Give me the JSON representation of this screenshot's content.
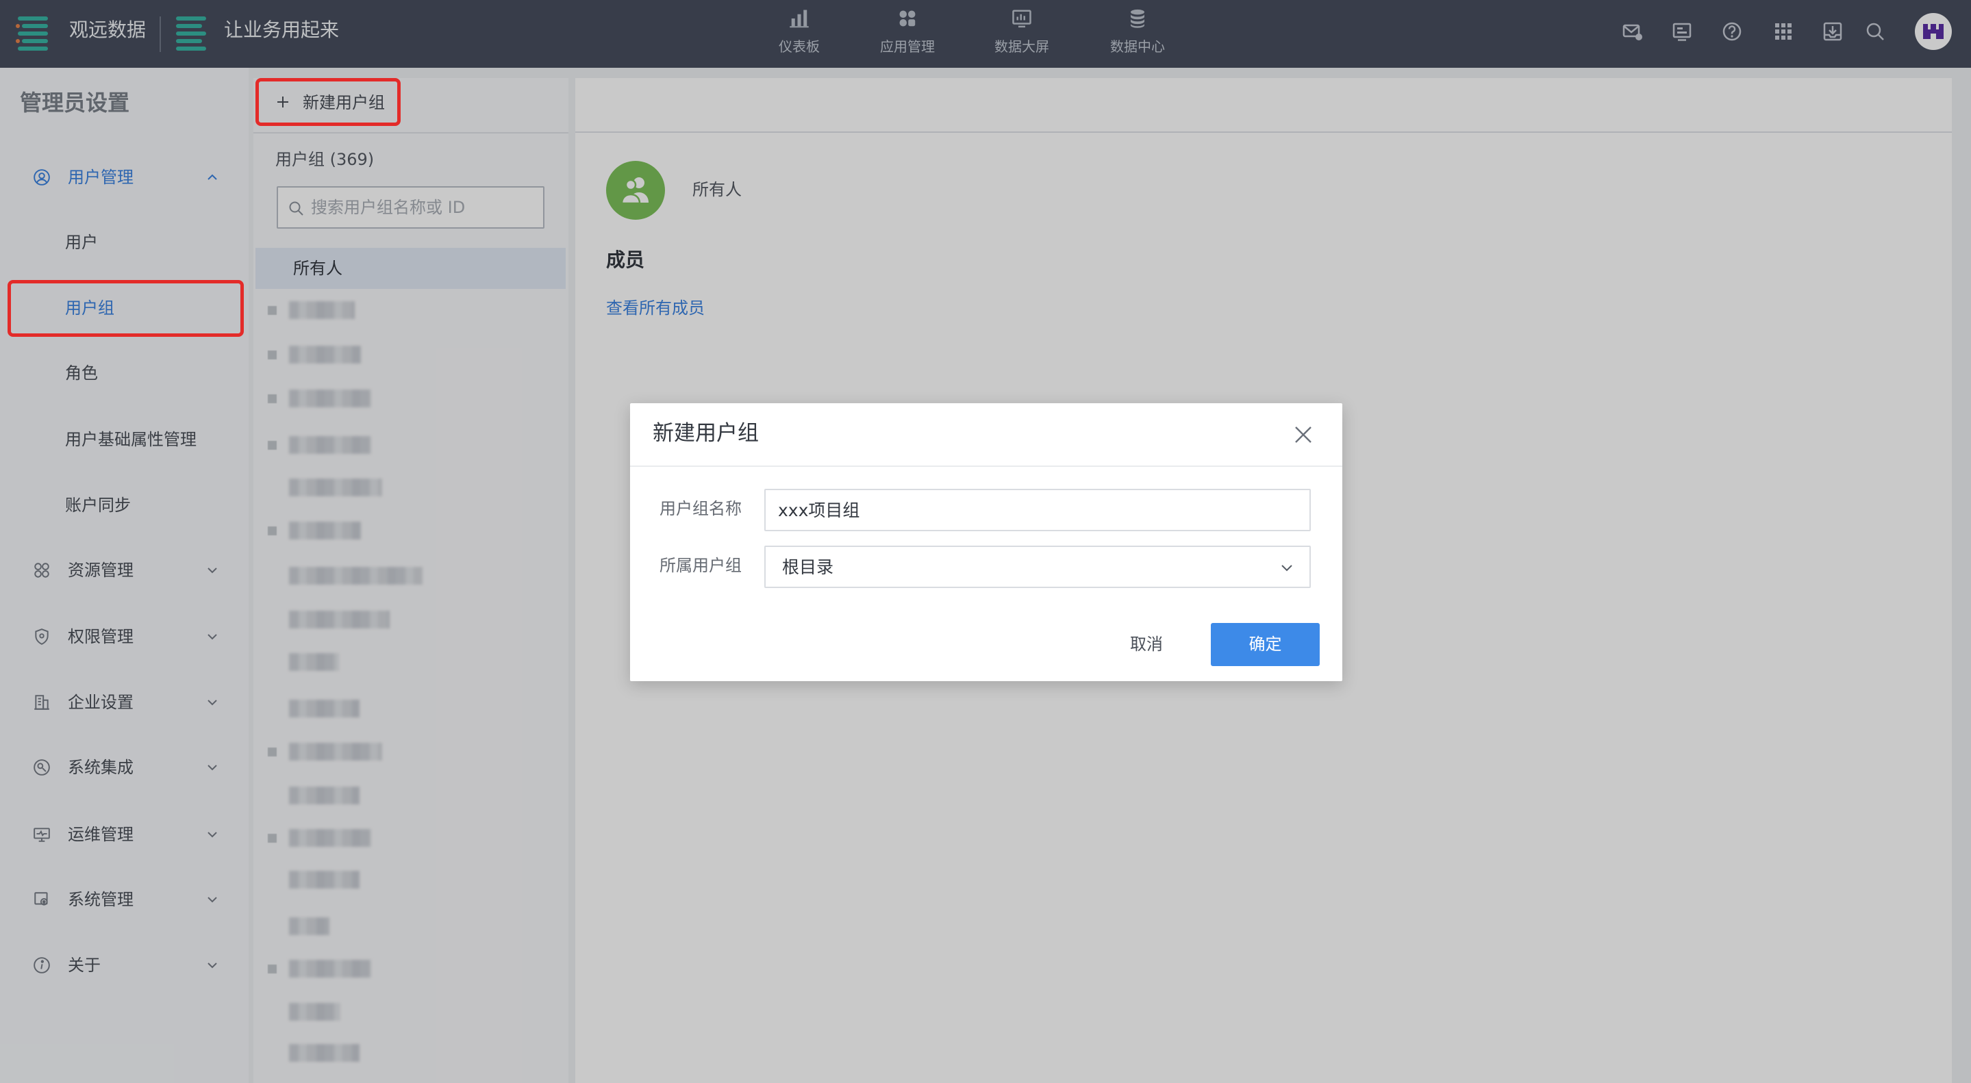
{
  "app": {
    "brand_name": "观远数据",
    "slogan": "让业务用起来"
  },
  "top_nav": [
    {
      "label": "仪表板",
      "icon": "bar-chart-icon"
    },
    {
      "label": "应用管理",
      "icon": "apps-icon"
    },
    {
      "label": "数据大屏",
      "icon": "data-screen-icon"
    },
    {
      "label": "数据中心",
      "icon": "database-icon"
    }
  ],
  "toolbar_icons": [
    "mail-icon",
    "screen-icon",
    "help-icon",
    "apps-grid-icon",
    "download-icon",
    "search-icon",
    "user-avatar"
  ],
  "sidebar": {
    "title": "管理员设置",
    "sections": [
      {
        "label": "用户管理",
        "icon": "user-circle-icon",
        "expanded": true,
        "active": true,
        "children": [
          {
            "label": "用户"
          },
          {
            "label": "用户组",
            "active": true
          },
          {
            "label": "角色"
          },
          {
            "label": "用户基础属性管理"
          },
          {
            "label": "账户同步"
          }
        ]
      },
      {
        "label": "资源管理",
        "icon": "resource-icon"
      },
      {
        "label": "权限管理",
        "icon": "shield-icon"
      },
      {
        "label": "企业设置",
        "icon": "building-icon"
      },
      {
        "label": "系统集成",
        "icon": "integration-icon"
      },
      {
        "label": "运维管理",
        "icon": "monitor-icon"
      },
      {
        "label": "系统管理",
        "icon": "settings-icon"
      },
      {
        "label": "关于",
        "icon": "info-icon"
      }
    ]
  },
  "groups_panel": {
    "new_group_button": "新建用户组",
    "count_label": "用户组 (369)",
    "search_placeholder": "搜索用户组名称或 ID",
    "selected_group": "所有人"
  },
  "group_detail": {
    "name": "所有人",
    "members_heading": "成员",
    "view_all_members_link": "查看所有成员"
  },
  "modal": {
    "title": "新建用户组",
    "fields": [
      {
        "label": "用户组名称",
        "value": "xxx项目组"
      },
      {
        "label": "所属用户组",
        "value": "根目录"
      }
    ],
    "cancel_label": "取消",
    "confirm_label": "确定"
  },
  "colors": {
    "topbar": "#474e5e",
    "accent": "#3d8ae8",
    "brand_teal": "#39b5a4",
    "group_avatar_green": "#7dc05a",
    "annotation_red": "#e32b29"
  }
}
